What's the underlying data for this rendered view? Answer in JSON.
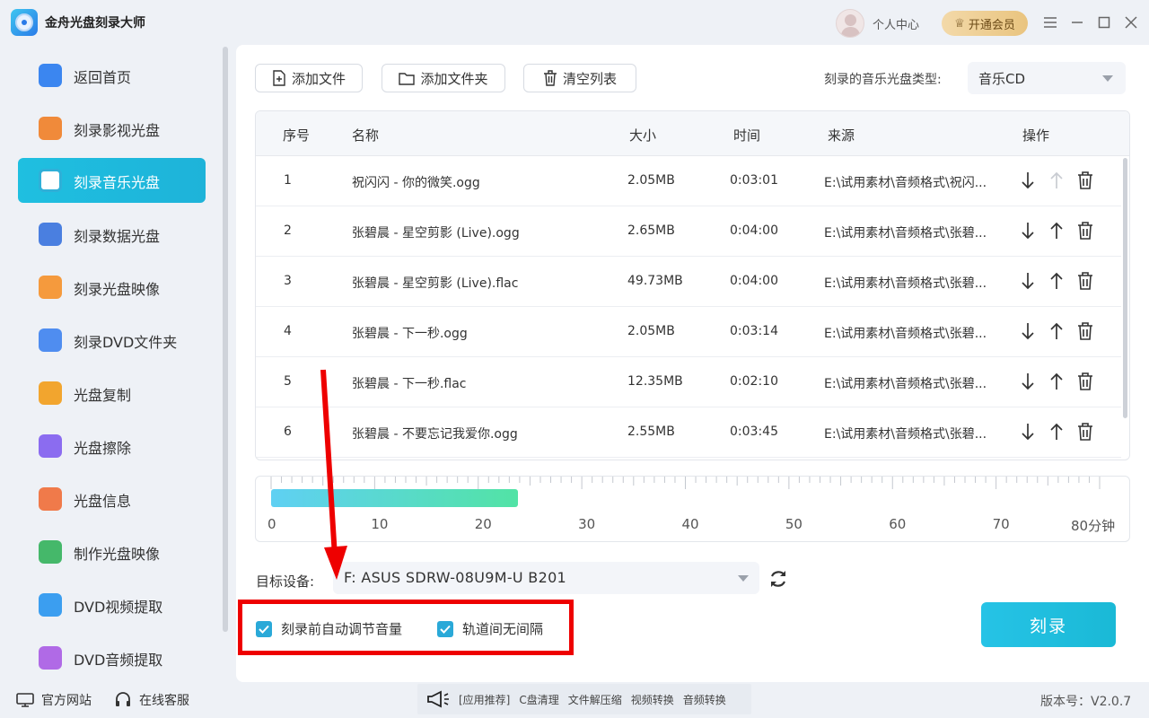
{
  "app": {
    "title": "金舟光盘刻录大师"
  },
  "header": {
    "user_center": "个人中心",
    "vip": "开通会员"
  },
  "sidebar": {
    "items": [
      {
        "label": "返回首页",
        "color": "#3b86f0"
      },
      {
        "label": "刻录影视光盘",
        "color": "#f08a3a"
      },
      {
        "label": "刻录音乐光盘",
        "color": "#2fb0d8"
      },
      {
        "label": "刻录数据光盘",
        "color": "#4a7fe0"
      },
      {
        "label": "刻录光盘映像",
        "color": "#f59a3d"
      },
      {
        "label": "刻录DVD文件夹",
        "color": "#4f8df0"
      },
      {
        "label": "光盘复制",
        "color": "#f2a52e"
      },
      {
        "label": "光盘擦除",
        "color": "#8b6cf0"
      },
      {
        "label": "光盘信息",
        "color": "#f07a4a"
      },
      {
        "label": "制作光盘映像",
        "color": "#45b86a"
      },
      {
        "label": "DVD视频提取",
        "color": "#3b9ef0"
      },
      {
        "label": "DVD音频提取",
        "color": "#b06ae6"
      }
    ]
  },
  "toolbar": {
    "add_file": "添加文件",
    "add_folder": "添加文件夹",
    "clear_list": "清空列表",
    "disc_type_label": "刻录的音乐光盘类型:",
    "disc_type_value": "音乐CD"
  },
  "table": {
    "headers": [
      "序号",
      "名称",
      "大小",
      "时间",
      "来源",
      "操作"
    ],
    "rows": [
      {
        "no": "1",
        "name": "祝闪闪 - 你的微笑.ogg",
        "size": "2.05MB",
        "time": "0:03:01",
        "source": "E:\\试用素材\\音频格式\\祝闪..."
      },
      {
        "no": "2",
        "name": "张碧晨 - 星空剪影 (Live).ogg",
        "size": "2.65MB",
        "time": "0:04:00",
        "source": "E:\\试用素材\\音频格式\\张碧..."
      },
      {
        "no": "3",
        "name": "张碧晨 - 星空剪影 (Live).flac",
        "size": "49.73MB",
        "time": "0:04:00",
        "source": "E:\\试用素材\\音频格式\\张碧..."
      },
      {
        "no": "4",
        "name": "张碧晨 - 下一秒.ogg",
        "size": "2.05MB",
        "time": "0:03:14",
        "source": "E:\\试用素材\\音频格式\\张碧..."
      },
      {
        "no": "5",
        "name": "张碧晨 - 下一秒.flac",
        "size": "12.35MB",
        "time": "0:02:10",
        "source": "E:\\试用素材\\音频格式\\张碧..."
      },
      {
        "no": "6",
        "name": "张碧晨 - 不要忘记我爱你.ogg",
        "size": "2.55MB",
        "time": "0:03:45",
        "source": "E:\\试用素材\\音频格式\\张碧..."
      }
    ]
  },
  "capacity": {
    "labels": [
      "0",
      "10",
      "20",
      "30",
      "40",
      "50",
      "60",
      "70",
      "80分钟"
    ],
    "max_minutes": 80,
    "used_minutes": 23.8
  },
  "device": {
    "label": "目标设备:",
    "value": "F: ASUS SDRW-08U9M-U B201"
  },
  "options": {
    "auto_volume": "刻录前自动调节音量",
    "no_gap": "轨道间无间隔"
  },
  "burn_button": "刻录",
  "footer": {
    "website": "官方网站",
    "support": "在线客服",
    "promo_items": [
      "[应用推荐]",
      "C盘清理",
      "文件解压缩",
      "视频转换",
      "音频转换"
    ],
    "version": "版本号：V2.0.7"
  }
}
